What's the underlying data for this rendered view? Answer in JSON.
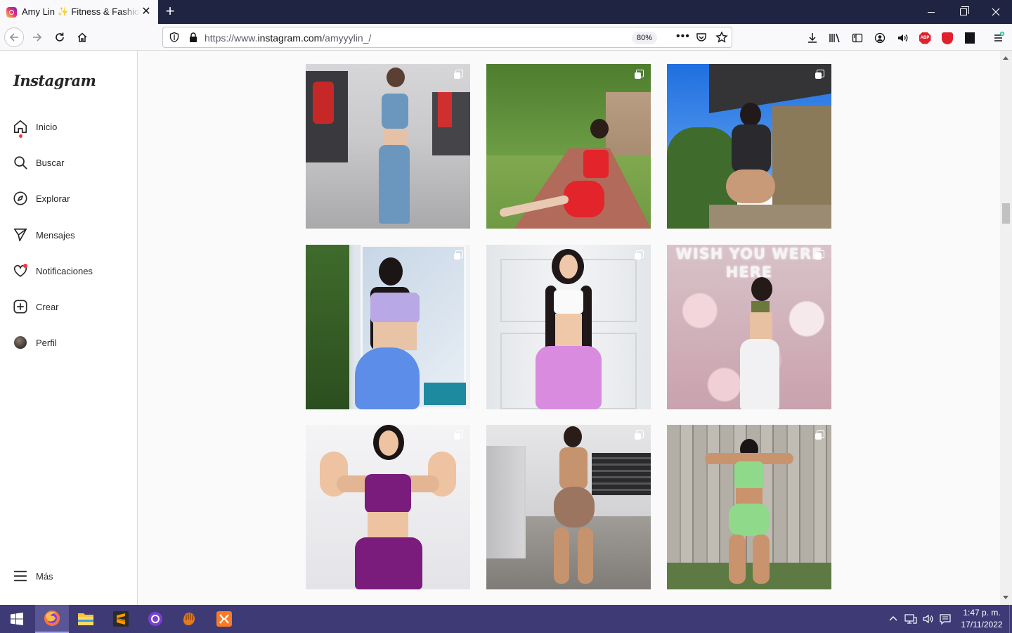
{
  "browser": {
    "tab_title": "Amy Lin ✨ Fitness & Fashion (@amyyylin_)",
    "url_prefix": "https://www.",
    "url_domain": "instagram.com",
    "url_path": "/amyyylin_/",
    "zoom": "80%",
    "new_tab": "+"
  },
  "instagram": {
    "logo": "Instagram",
    "nav": [
      {
        "label": "Inicio",
        "icon": "home-icon",
        "badge": true
      },
      {
        "label": "Buscar",
        "icon": "search-icon"
      },
      {
        "label": "Explorar",
        "icon": "compass-icon"
      },
      {
        "label": "Mensajes",
        "icon": "send-icon"
      },
      {
        "label": "Notificaciones",
        "icon": "heart-icon",
        "badge": true
      },
      {
        "label": "Crear",
        "icon": "plus-square-icon"
      },
      {
        "label": "Perfil",
        "icon": "avatar"
      }
    ],
    "more_label": "Más",
    "posts": [
      {
        "scene": "gym mirror selfie, blue set",
        "bg": [
          "#c9c9cb",
          "#7a7a7e"
        ],
        "outfit": "#6b97be",
        "multi": true
      },
      {
        "scene": "park path, red set",
        "bg": [
          "#5f8d3a",
          "#b26a5a"
        ],
        "outfit": "#e3242b",
        "multi": true
      },
      {
        "scene": "porch, black outfit, blue sky",
        "bg": [
          "#2f7fe0",
          "#5b6a46"
        ],
        "outfit": "#2a2a2e",
        "multi": true
      },
      {
        "scene": "greenhouse, lavender top, blue shorts",
        "bg": [
          "#dfe6ee",
          "#7c8b5a"
        ],
        "outfit": "#5c8de8",
        "multi": true
      },
      {
        "scene": "white door, white top, pink ombre shorts",
        "bg": [
          "#eef0f2",
          "#d7dadd"
        ],
        "outfit": "#d98be0",
        "multi": true
      },
      {
        "scene": "flower wall, WISH YOU WERE HERE",
        "bg": [
          "#d9c4c9",
          "#b98c98"
        ],
        "outfit": "#f1f1f3",
        "multi": true,
        "sign": "WISH YOU WERE HERE"
      },
      {
        "scene": "flexing, purple set",
        "bg": [
          "#f2f2f4",
          "#e6e6ea"
        ],
        "outfit": "#7a1c7c",
        "multi": true
      },
      {
        "scene": "gym mirror, brown set",
        "bg": [
          "#d9d9db",
          "#8d8a86"
        ],
        "outfit": "#9b7560",
        "multi": true
      },
      {
        "scene": "wooden fence, mint set",
        "bg": [
          "#a9a69e",
          "#5e7a44"
        ],
        "outfit": "#8fd98a",
        "multi": true
      }
    ]
  },
  "taskbar": {
    "time": "1:47 p. m.",
    "date": "17/11/2022",
    "apps": [
      "windows-start-icon",
      "firefox-icon",
      "file-explorer-icon",
      "sublime-text-icon",
      "github-desktop-icon",
      "baseball-glove-icon",
      "xampp-icon"
    ]
  },
  "colors": {
    "titlebar": "#1f2442",
    "taskbar": "#3e3a76",
    "ig_badge": "#ff3040"
  }
}
